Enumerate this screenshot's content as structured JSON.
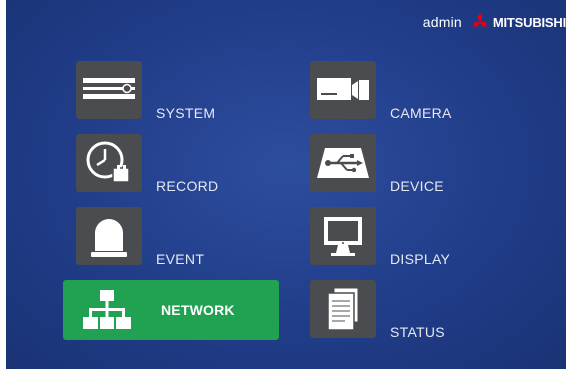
{
  "header": {
    "user": "admin",
    "brand": "MITSUBISHI",
    "brand_logo": "three-diamonds-logo-icon",
    "brand_color": "#e60012"
  },
  "colors": {
    "background": "#213d89",
    "tile": "#4b4c4f",
    "selected": "#21a152",
    "label": "#e6e9f2"
  },
  "menu": {
    "system": {
      "label": "SYSTEM",
      "icon": "recorder-icon"
    },
    "record": {
      "label": "RECORD",
      "icon": "clock-schedule-icon"
    },
    "event": {
      "label": "EVENT",
      "icon": "dome-alarm-icon"
    },
    "network": {
      "label": "NETWORK",
      "icon": "network-icon",
      "selected": true
    },
    "camera": {
      "label": "CAMERA",
      "icon": "camera-icon"
    },
    "device": {
      "label": "DEVICE",
      "icon": "usb-device-icon"
    },
    "display": {
      "label": "DISPLAY",
      "icon": "monitor-icon"
    },
    "status": {
      "label": "STATUS",
      "icon": "document-icon"
    }
  }
}
